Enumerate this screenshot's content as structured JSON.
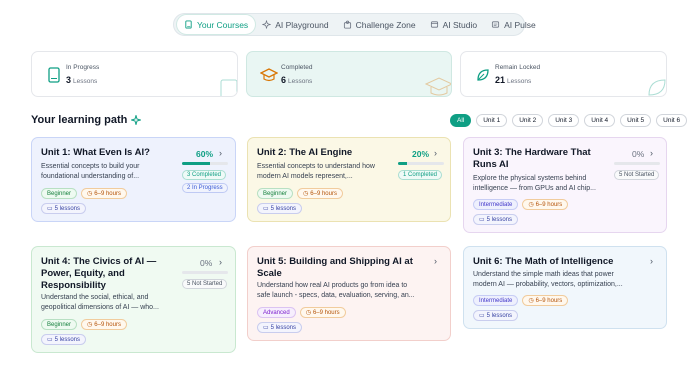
{
  "nav": {
    "tabs": [
      {
        "label": "Your Courses",
        "icon": "book-icon"
      },
      {
        "label": "AI Playground",
        "icon": "sparkle-icon"
      },
      {
        "label": "Challenge Zone",
        "icon": "puzzle-icon"
      },
      {
        "label": "AI Studio",
        "icon": "studio-icon"
      },
      {
        "label": "AI Pulse",
        "icon": "pulse-icon"
      }
    ],
    "active": "Your Courses"
  },
  "stats": {
    "in_progress": {
      "label": "In Progress",
      "value": "3",
      "unit": "Lessons"
    },
    "completed": {
      "label": "Completed",
      "value": "6",
      "unit": "Lessons"
    },
    "locked": {
      "label": "Remain Locked",
      "value": "21",
      "unit": "Lessons"
    }
  },
  "learning_path": {
    "title": "Your learning path",
    "filters": [
      "All",
      "Unit 1",
      "Unit 2",
      "Unit 3",
      "Unit 4",
      "Unit 5",
      "Unit 6"
    ]
  },
  "units": [
    {
      "title": "Unit 1: What Even Is AI?",
      "desc1": "Essential concepts to build your",
      "desc2": "foundational understanding of...",
      "percent": "60%",
      "progress": 0.6,
      "status1": "3 Completed",
      "status2": "2 In Progress",
      "level": "Beginner",
      "hours": "6–9 hours",
      "lessons": "5 lessons"
    },
    {
      "title": "Unit 2: The AI Engine",
      "desc1": "Essential concepts to understand how",
      "desc2": "modern AI models represent,...",
      "percent": "20%",
      "progress": 0.2,
      "status1": "1 Completed",
      "level": "Beginner",
      "hours": "6–9 hours",
      "lessons": "5 lessons"
    },
    {
      "title1": "Unit 3: The Hardware That",
      "title2": "Runs AI",
      "desc1": "Explore the physical systems behind",
      "desc2": "intelligence — from GPUs and AI chip...",
      "percent": "0%",
      "progress": 0,
      "status1": "5 Not Started",
      "level": "Intermediate",
      "hours": "6–9 hours",
      "lessons": "5 lessons"
    },
    {
      "title1": "Unit 4: The Civics of AI —",
      "title2": "Power, Equity, and",
      "title3": "Responsibility",
      "desc1": "Understand the social, ethical, and",
      "desc2": "geopolitical dimensions of AI — who...",
      "percent": "0%",
      "progress": 0,
      "status1": "5 Not Started",
      "level": "Beginner",
      "hours": "6–9 hours",
      "lessons": "5 lessons"
    },
    {
      "title1": "Unit 5: Building and Shipping AI at",
      "title2": "Scale",
      "desc1": "Understand how real AI products go from idea to",
      "desc2": "safe launch - specs, data, evaluation, serving, an...",
      "level": "Advanced",
      "hours": "6–9 hours",
      "lessons": "5 lessons"
    },
    {
      "title": "Unit 6: The Math of Intelligence",
      "desc1": "Understand the simple math ideas that power",
      "desc2": "modern AI — probability, vectors, optimization,...",
      "level": "Intermediate",
      "hours": "6–9 hours",
      "lessons": "5 lessons"
    }
  ],
  "colors": {
    "accent": "#0f9f84"
  }
}
